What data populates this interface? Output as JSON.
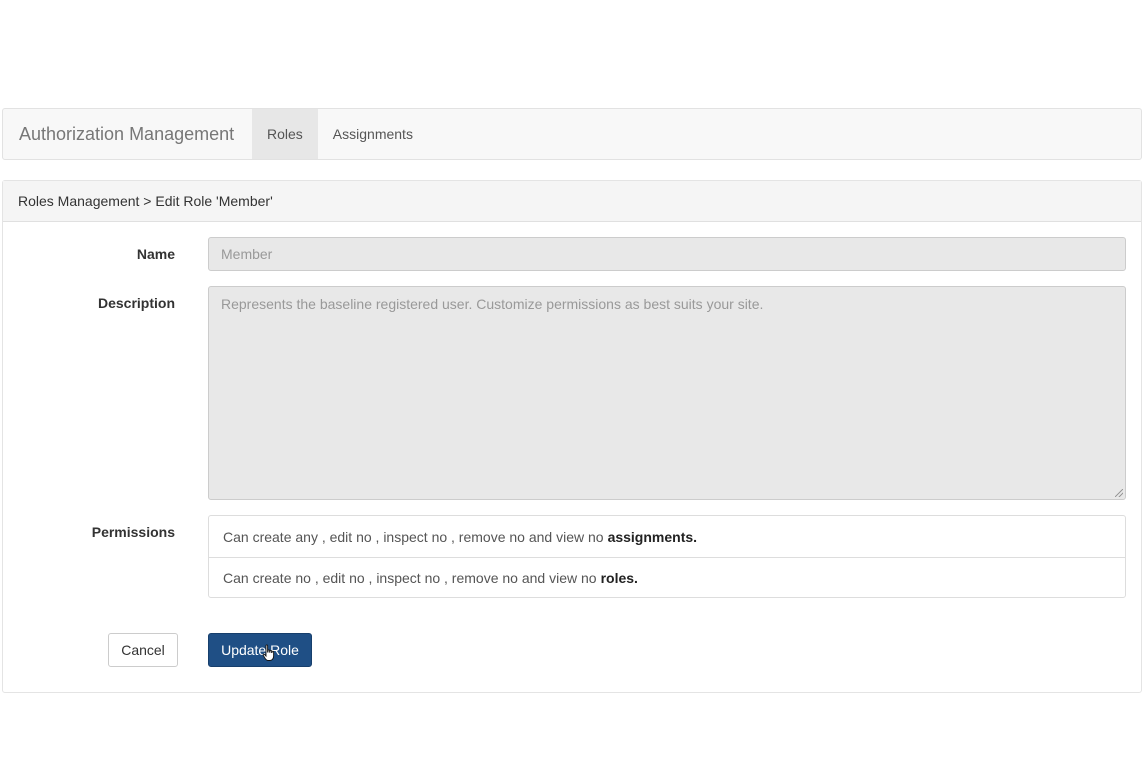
{
  "navbar": {
    "brand": "Authorization Management",
    "items": [
      {
        "label": "Roles",
        "active": true
      },
      {
        "label": "Assignments",
        "active": false
      }
    ]
  },
  "panel": {
    "breadcrumb": "Roles Management > Edit Role 'Member'"
  },
  "form": {
    "name_label": "Name",
    "name_value": "Member",
    "description_label": "Description",
    "description_value": "Represents the baseline registered user. Customize permissions as best suits your site.",
    "permissions_label": "Permissions",
    "permissions": [
      {
        "text": "Can create any , edit no , inspect no , remove no and view no",
        "entity": "assignments."
      },
      {
        "text": "Can create no , edit no , inspect no , remove no and view no",
        "entity": "roles."
      }
    ]
  },
  "buttons": {
    "cancel": "Cancel",
    "update": "Update Role"
  },
  "colors": {
    "primary": "#1f4f85",
    "navbar_bg": "#f8f8f8",
    "readonly_bg": "#e8e8e8"
  },
  "icons": {
    "cursor": "hand-pointer-icon"
  }
}
